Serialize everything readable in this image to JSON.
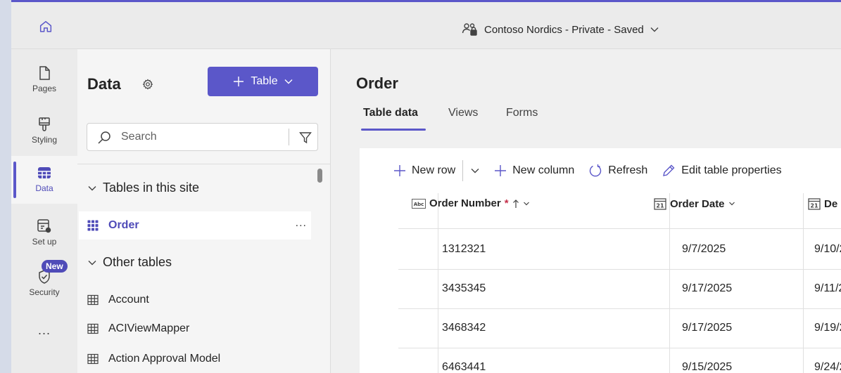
{
  "header": {
    "site_title": "Contoso Nordics - Private - Saved"
  },
  "nav": {
    "pages": "Pages",
    "styling": "Styling",
    "data": "Data",
    "setup": "Set up",
    "security": "Security",
    "new_badge": "New",
    "more": "..."
  },
  "panel": {
    "title": "Data",
    "table_button": "Table",
    "search_placeholder": "Search",
    "section_site": "Tables in this site",
    "section_other": "Other tables",
    "site_tables": [
      "Order"
    ],
    "item_more": "...",
    "other_tables": [
      "Account",
      "ACIViewMapper",
      "Action Approval Model"
    ]
  },
  "main": {
    "title": "Order",
    "tabs": [
      "Table data",
      "Views",
      "Forms"
    ],
    "toolbar": {
      "new_row": "New row",
      "new_column": "New column",
      "refresh": "Refresh",
      "edit_props": "Edit table properties"
    },
    "columns": [
      "Order Number",
      "Order Date",
      "De"
    ],
    "required_mark": "*",
    "rows": [
      [
        "1312321",
        "9/7/2025",
        "9/10/2"
      ],
      [
        "3435345",
        "9/17/2025",
        "9/11/2"
      ],
      [
        "3468342",
        "9/17/2025",
        "9/19/2"
      ],
      [
        "6463441",
        "9/15/2025",
        "9/24/2"
      ]
    ]
  },
  "colors": {
    "accent": "#5b57c9",
    "accent_text": "#4f4bb8",
    "required": "#c4314b"
  }
}
